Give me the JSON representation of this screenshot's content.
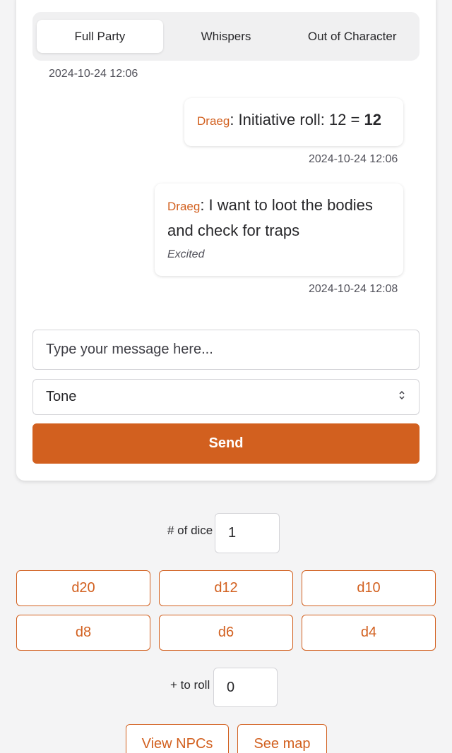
{
  "tabs": [
    {
      "label": "Full Party",
      "active": true
    },
    {
      "label": "Whispers",
      "active": false
    },
    {
      "label": "Out of Character",
      "active": false
    }
  ],
  "messages": [
    {
      "timestamp_before": "2024-10-24 12:06"
    },
    {
      "sender": "Draeg",
      "text": "Initiative roll: 12 = ",
      "result": "12",
      "timestamp": "2024-10-24 12:06"
    },
    {
      "sender": "Draeg",
      "text_line1": "I want to loot the bodies",
      "text_line2": "and check for traps",
      "tone": "Excited",
      "timestamp": "2024-10-24 12:08"
    }
  ],
  "composer": {
    "message_placeholder": "Type your message here...",
    "tone_label": "Tone",
    "send_label": "Send"
  },
  "dice": {
    "count_label": "# of dice",
    "count_value": "1",
    "buttons": [
      "d20",
      "d12",
      "d10",
      "d8",
      "d6",
      "d4"
    ],
    "modifier_label": "+ to roll",
    "modifier_value": "0"
  },
  "footer": {
    "npcs_label": "View NPCs",
    "map_label": "See map"
  },
  "colors": {
    "accent": "#d2601f"
  }
}
